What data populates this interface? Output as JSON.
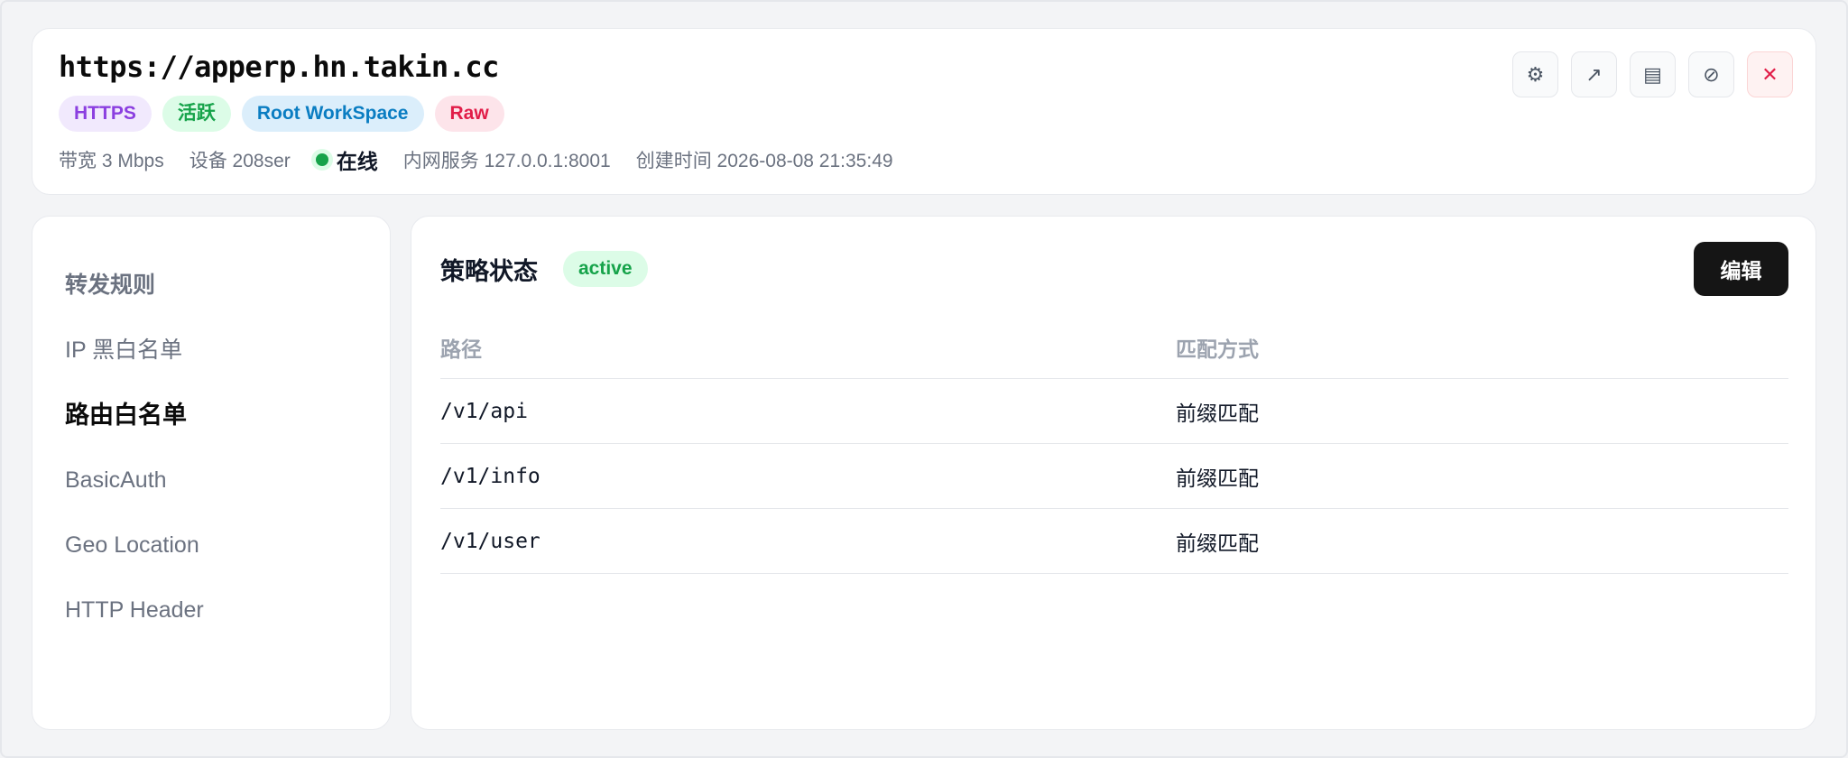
{
  "header": {
    "url": "https://apperp.hn.takin.cc",
    "badges": {
      "protocol": "HTTPS",
      "state": "活跃",
      "workspace": "Root WorkSpace",
      "mode": "Raw"
    },
    "meta": {
      "bandwidth": "带宽 3 Mbps",
      "device": "设备 208ser",
      "online": "在线",
      "internal": "内网服务 127.0.0.1:8001",
      "created": "创建时间 2026-08-08 21:35:49"
    },
    "actions": {
      "settings_glyph": "⚙",
      "open_glyph": "↗",
      "logs_glyph": "▤",
      "disable_glyph": "⊘",
      "close_glyph": "✕"
    }
  },
  "sidebar": {
    "items": [
      "转发规则",
      "IP 黑白名单",
      "路由白名单",
      "BasicAuth",
      "Geo Location",
      "HTTP Header"
    ],
    "selected_index": 2
  },
  "main": {
    "title": "策略状态",
    "status": "active",
    "edit_label": "编辑",
    "table": {
      "columns": [
        "路径",
        "匹配方式"
      ],
      "rows": [
        [
          "/v1/api",
          "前缀匹配"
        ],
        [
          "/v1/info",
          "前缀匹配"
        ],
        [
          "/v1/user",
          "前缀匹配"
        ]
      ]
    }
  },
  "colors": {
    "accent_green": "#16a34a",
    "https_purple": "#8b3fe0",
    "workspace_blue": "#0a7dc2",
    "raw_red": "#e11d48",
    "edit_button": "#151515"
  }
}
